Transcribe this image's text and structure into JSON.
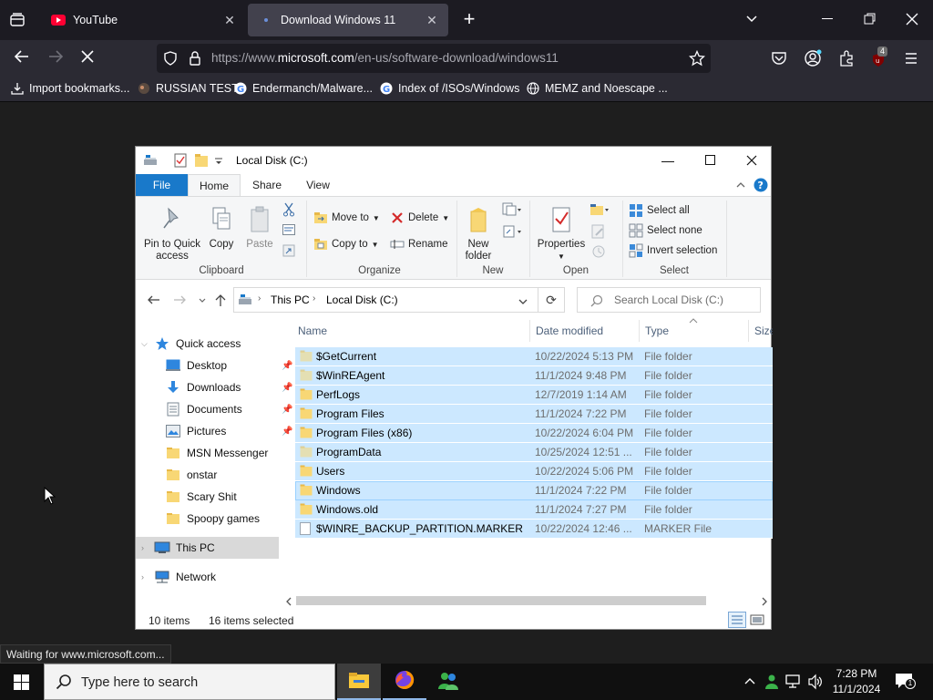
{
  "browser": {
    "tabs": [
      {
        "title": "YouTube",
        "active": false,
        "icon": "youtube-icon"
      },
      {
        "title": "Download Windows 11",
        "active": true,
        "icon": "microsoft-icon"
      }
    ],
    "new_tab_symbol": "+",
    "url_prefix": "https://www.",
    "url_domain": "microsoft.com",
    "url_path": "/en-us/software-download/windows11",
    "extension_badge": "4",
    "bookmarks": [
      {
        "label": "Import bookmarks...",
        "icon": "import-icon"
      },
      {
        "label": "RUSSIAN TEST",
        "icon": "globe-icon"
      },
      {
        "label": "Endermanch/Malware...",
        "icon": "google-icon"
      },
      {
        "label": "Index of /ISOs/Windows",
        "icon": "google-icon"
      },
      {
        "label": "MEMZ and Noescape ...",
        "icon": "globe-icon"
      }
    ],
    "status": "Waiting for www.microsoft.com..."
  },
  "explorer": {
    "title": "Local Disk (C:)",
    "ribbon_tabs": [
      "File",
      "Home",
      "Share",
      "View"
    ],
    "clipboard": {
      "pin": "Pin to Quick access",
      "copy": "Copy",
      "paste": "Paste",
      "label": "Clipboard"
    },
    "organize": {
      "move_to": "Move to",
      "copy_to": "Copy to",
      "delete": "Delete",
      "rename": "Rename",
      "label": "Organize"
    },
    "new": {
      "new_folder": "New folder",
      "label": "New"
    },
    "open": {
      "properties": "Properties",
      "label": "Open"
    },
    "select": {
      "select_all": "Select all",
      "select_none": "Select none",
      "invert": "Invert selection",
      "label": "Select"
    },
    "breadcrumb": [
      "This PC",
      "Local Disk (C:)"
    ],
    "search_placeholder": "Search Local Disk (C:)",
    "columns": [
      "Name",
      "Date modified",
      "Type",
      "Size"
    ],
    "nav": {
      "quick_access": "Quick access",
      "pinned": [
        "Desktop",
        "Downloads",
        "Documents",
        "Pictures"
      ],
      "folders": [
        "MSN Messenger",
        "onstar",
        "Scary Shit",
        "Spoopy games"
      ],
      "this_pc": "This PC",
      "network": "Network"
    },
    "files": [
      {
        "name": "$GetCurrent",
        "date": "10/22/2024 5:13 PM",
        "type": "File folder",
        "kind": "folder-faded"
      },
      {
        "name": "$WinREAgent",
        "date": "11/1/2024 9:48 PM",
        "type": "File folder",
        "kind": "folder-faded"
      },
      {
        "name": "PerfLogs",
        "date": "12/7/2019 1:14 AM",
        "type": "File folder",
        "kind": "folder"
      },
      {
        "name": "Program Files",
        "date": "11/1/2024 7:22 PM",
        "type": "File folder",
        "kind": "folder"
      },
      {
        "name": "Program Files (x86)",
        "date": "10/22/2024 6:04 PM",
        "type": "File folder",
        "kind": "folder"
      },
      {
        "name": "ProgramData",
        "date": "10/25/2024 12:51 ...",
        "type": "File folder",
        "kind": "folder-faded"
      },
      {
        "name": "Users",
        "date": "10/22/2024 5:06 PM",
        "type": "File folder",
        "kind": "folder"
      },
      {
        "name": "Windows",
        "date": "11/1/2024 7:22 PM",
        "type": "File folder",
        "kind": "folder"
      },
      {
        "name": "Windows.old",
        "date": "11/1/2024 7:27 PM",
        "type": "File folder",
        "kind": "folder"
      },
      {
        "name": "$WINRE_BACKUP_PARTITION.MARKER",
        "date": "10/22/2024 12:46 ...",
        "type": "MARKER File",
        "kind": "file"
      }
    ],
    "status_items": "10 items",
    "status_selected": "16 items selected"
  },
  "taskbar": {
    "search_placeholder": "Type here to search",
    "time": "7:28 PM",
    "date": "11/1/2024",
    "notification_count": "1"
  },
  "colors": {
    "accent": "#1979ca",
    "selection": "#cce8ff",
    "folder": "#f8d775"
  }
}
